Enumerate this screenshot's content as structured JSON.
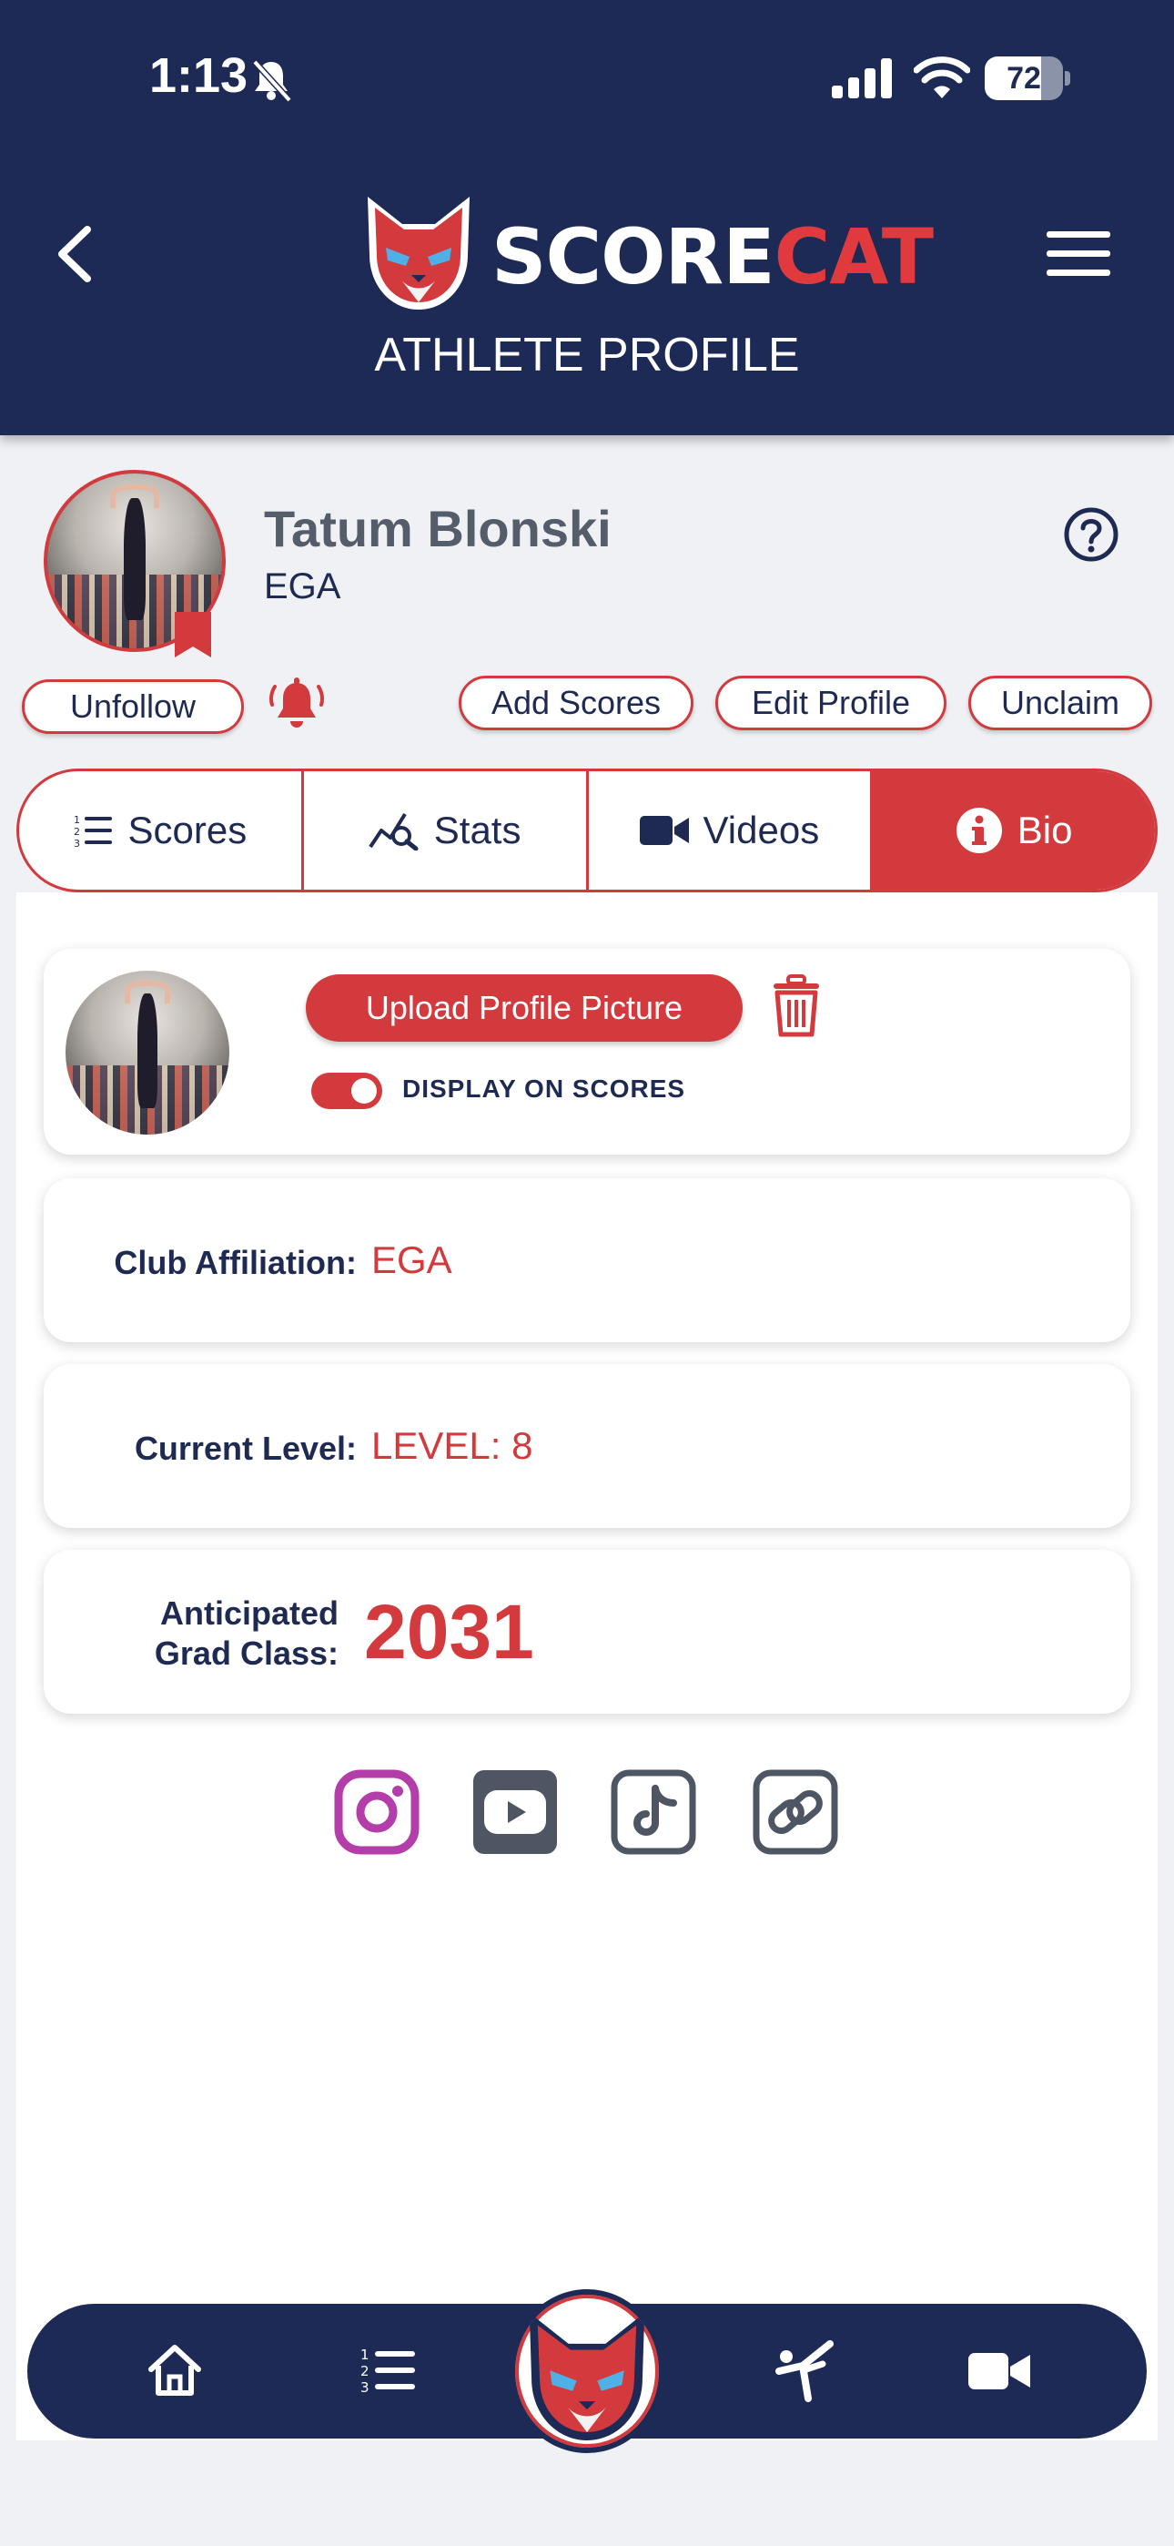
{
  "status_bar": {
    "time": "1:13",
    "battery": "72",
    "battery_level": 0.72
  },
  "header": {
    "logo_white": "SCORE",
    "logo_red": "CAT",
    "subtitle": "ATHLETE PROFILE"
  },
  "profile": {
    "name": "Tatum Blonski",
    "club": "EGA"
  },
  "actions": {
    "unfollow": "Unfollow",
    "add_scores": "Add Scores",
    "edit_profile": "Edit Profile",
    "unclaim": "Unclaim"
  },
  "tabs": [
    {
      "label": "Scores",
      "icon": "numbered-list-icon"
    },
    {
      "label": "Stats",
      "icon": "chart-search-icon"
    },
    {
      "label": "Videos",
      "icon": "video-camera-icon"
    },
    {
      "label": "Bio",
      "icon": "info-icon",
      "active": true
    }
  ],
  "bio": {
    "upload_label": "Upload Profile Picture",
    "display_on_scores_label": "DISPLAY ON SCORES",
    "display_on_scores": true,
    "club_affiliation_label": "Club Affiliation:",
    "club_affiliation_value": "EGA",
    "current_level_label": "Current Level:",
    "current_level_value": "LEVEL: 8",
    "grad_label_line1": "Anticipated",
    "grad_label_line2": "Grad Class:",
    "grad_value": "2031"
  },
  "social": [
    "instagram-icon",
    "youtube-icon",
    "tiktok-icon",
    "link-icon"
  ],
  "bottom_nav": [
    "home-icon",
    "numbered-list-icon",
    "scorecat-logo",
    "gymnast-icon",
    "video-camera-icon"
  ],
  "colors": {
    "navy": "#1c2a55",
    "red": "#d23a3e",
    "instagram": "#b43ea9",
    "gray_icon": "#4f5663"
  }
}
